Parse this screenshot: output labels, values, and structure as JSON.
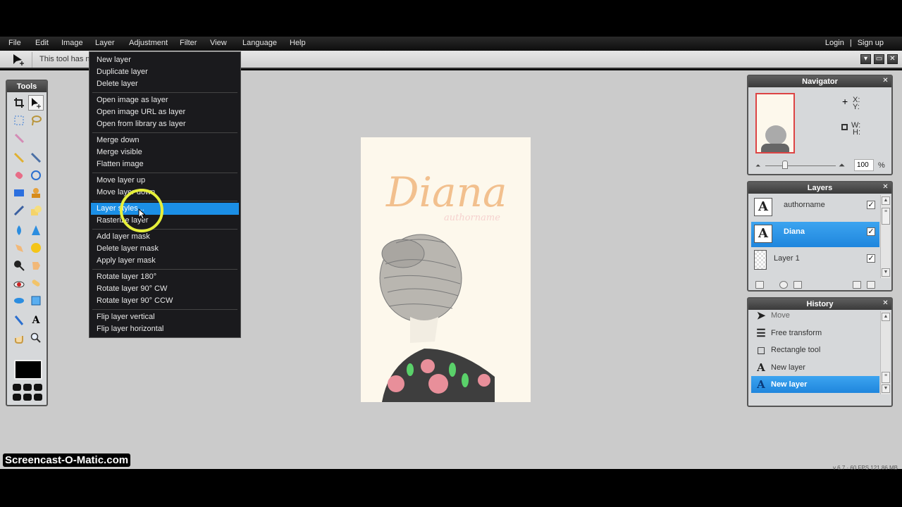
{
  "menubar": {
    "items": [
      "File",
      "Edit",
      "Image",
      "Layer",
      "Adjustment",
      "Filter",
      "View",
      "Language",
      "Help"
    ],
    "login": "Login",
    "separator": "|",
    "signup": "Sign up"
  },
  "options_bar": {
    "hint": "This tool has no options."
  },
  "window_controls": {
    "minimize": "▾",
    "restore": "▭",
    "close": "✕"
  },
  "layer_menu": {
    "groups": [
      [
        "New layer",
        "Duplicate layer",
        "Delete layer"
      ],
      [
        "Open image as layer",
        "Open image URL as layer",
        "Open from library as layer"
      ],
      [
        "Merge down",
        "Merge visible",
        "Flatten image"
      ],
      [
        "Move layer up",
        "Move layer down"
      ],
      [
        "Layer styles...",
        "Rasterize layer"
      ],
      [
        "Add layer mask",
        "Delete layer mask",
        "Apply layer mask"
      ],
      [
        "Rotate layer 180°",
        "Rotate layer 90° CW",
        "Rotate layer 90° CCW"
      ],
      [
        "Flip layer vertical",
        "Flip layer horizontal"
      ]
    ],
    "highlighted": "Layer styles..."
  },
  "tools_panel": {
    "title": "Tools"
  },
  "navigator": {
    "title": "Navigator",
    "x_label": "X:",
    "y_label": "Y:",
    "w_label": "W:",
    "h_label": "H:",
    "zoom_value": "100",
    "zoom_unit": "%"
  },
  "layers": {
    "title": "Layers",
    "items": [
      {
        "name": "authorname",
        "thumb": "A",
        "visible": true,
        "selected": false
      },
      {
        "name": "Diana",
        "thumb": "A",
        "visible": true,
        "selected": true
      },
      {
        "name": "Layer 1",
        "thumb": "",
        "visible": true,
        "selected": false
      }
    ]
  },
  "history": {
    "title": "History",
    "items": [
      {
        "label": "Move",
        "icon": "move-icon"
      },
      {
        "label": "Free transform",
        "icon": "free-transform-icon"
      },
      {
        "label": "Rectangle tool",
        "icon": "rectangle-tool-icon"
      },
      {
        "label": "New layer",
        "icon": "text-layer-icon"
      },
      {
        "label": "New layer",
        "icon": "text-layer-icon",
        "selected": true
      }
    ]
  },
  "canvas": {
    "title_text": "Diana",
    "subtitle_text": "authorname",
    "colors": {
      "title": "#f2c08e",
      "subtitle": "#f6d2cf",
      "background": "#fdf8ec"
    }
  },
  "foreground_color": "#000000",
  "status": "v 6.7 · 60 FPS 121.86 MB",
  "watermark": "Screencast-O-Matic.com",
  "accent_color": "#1b8fe6"
}
